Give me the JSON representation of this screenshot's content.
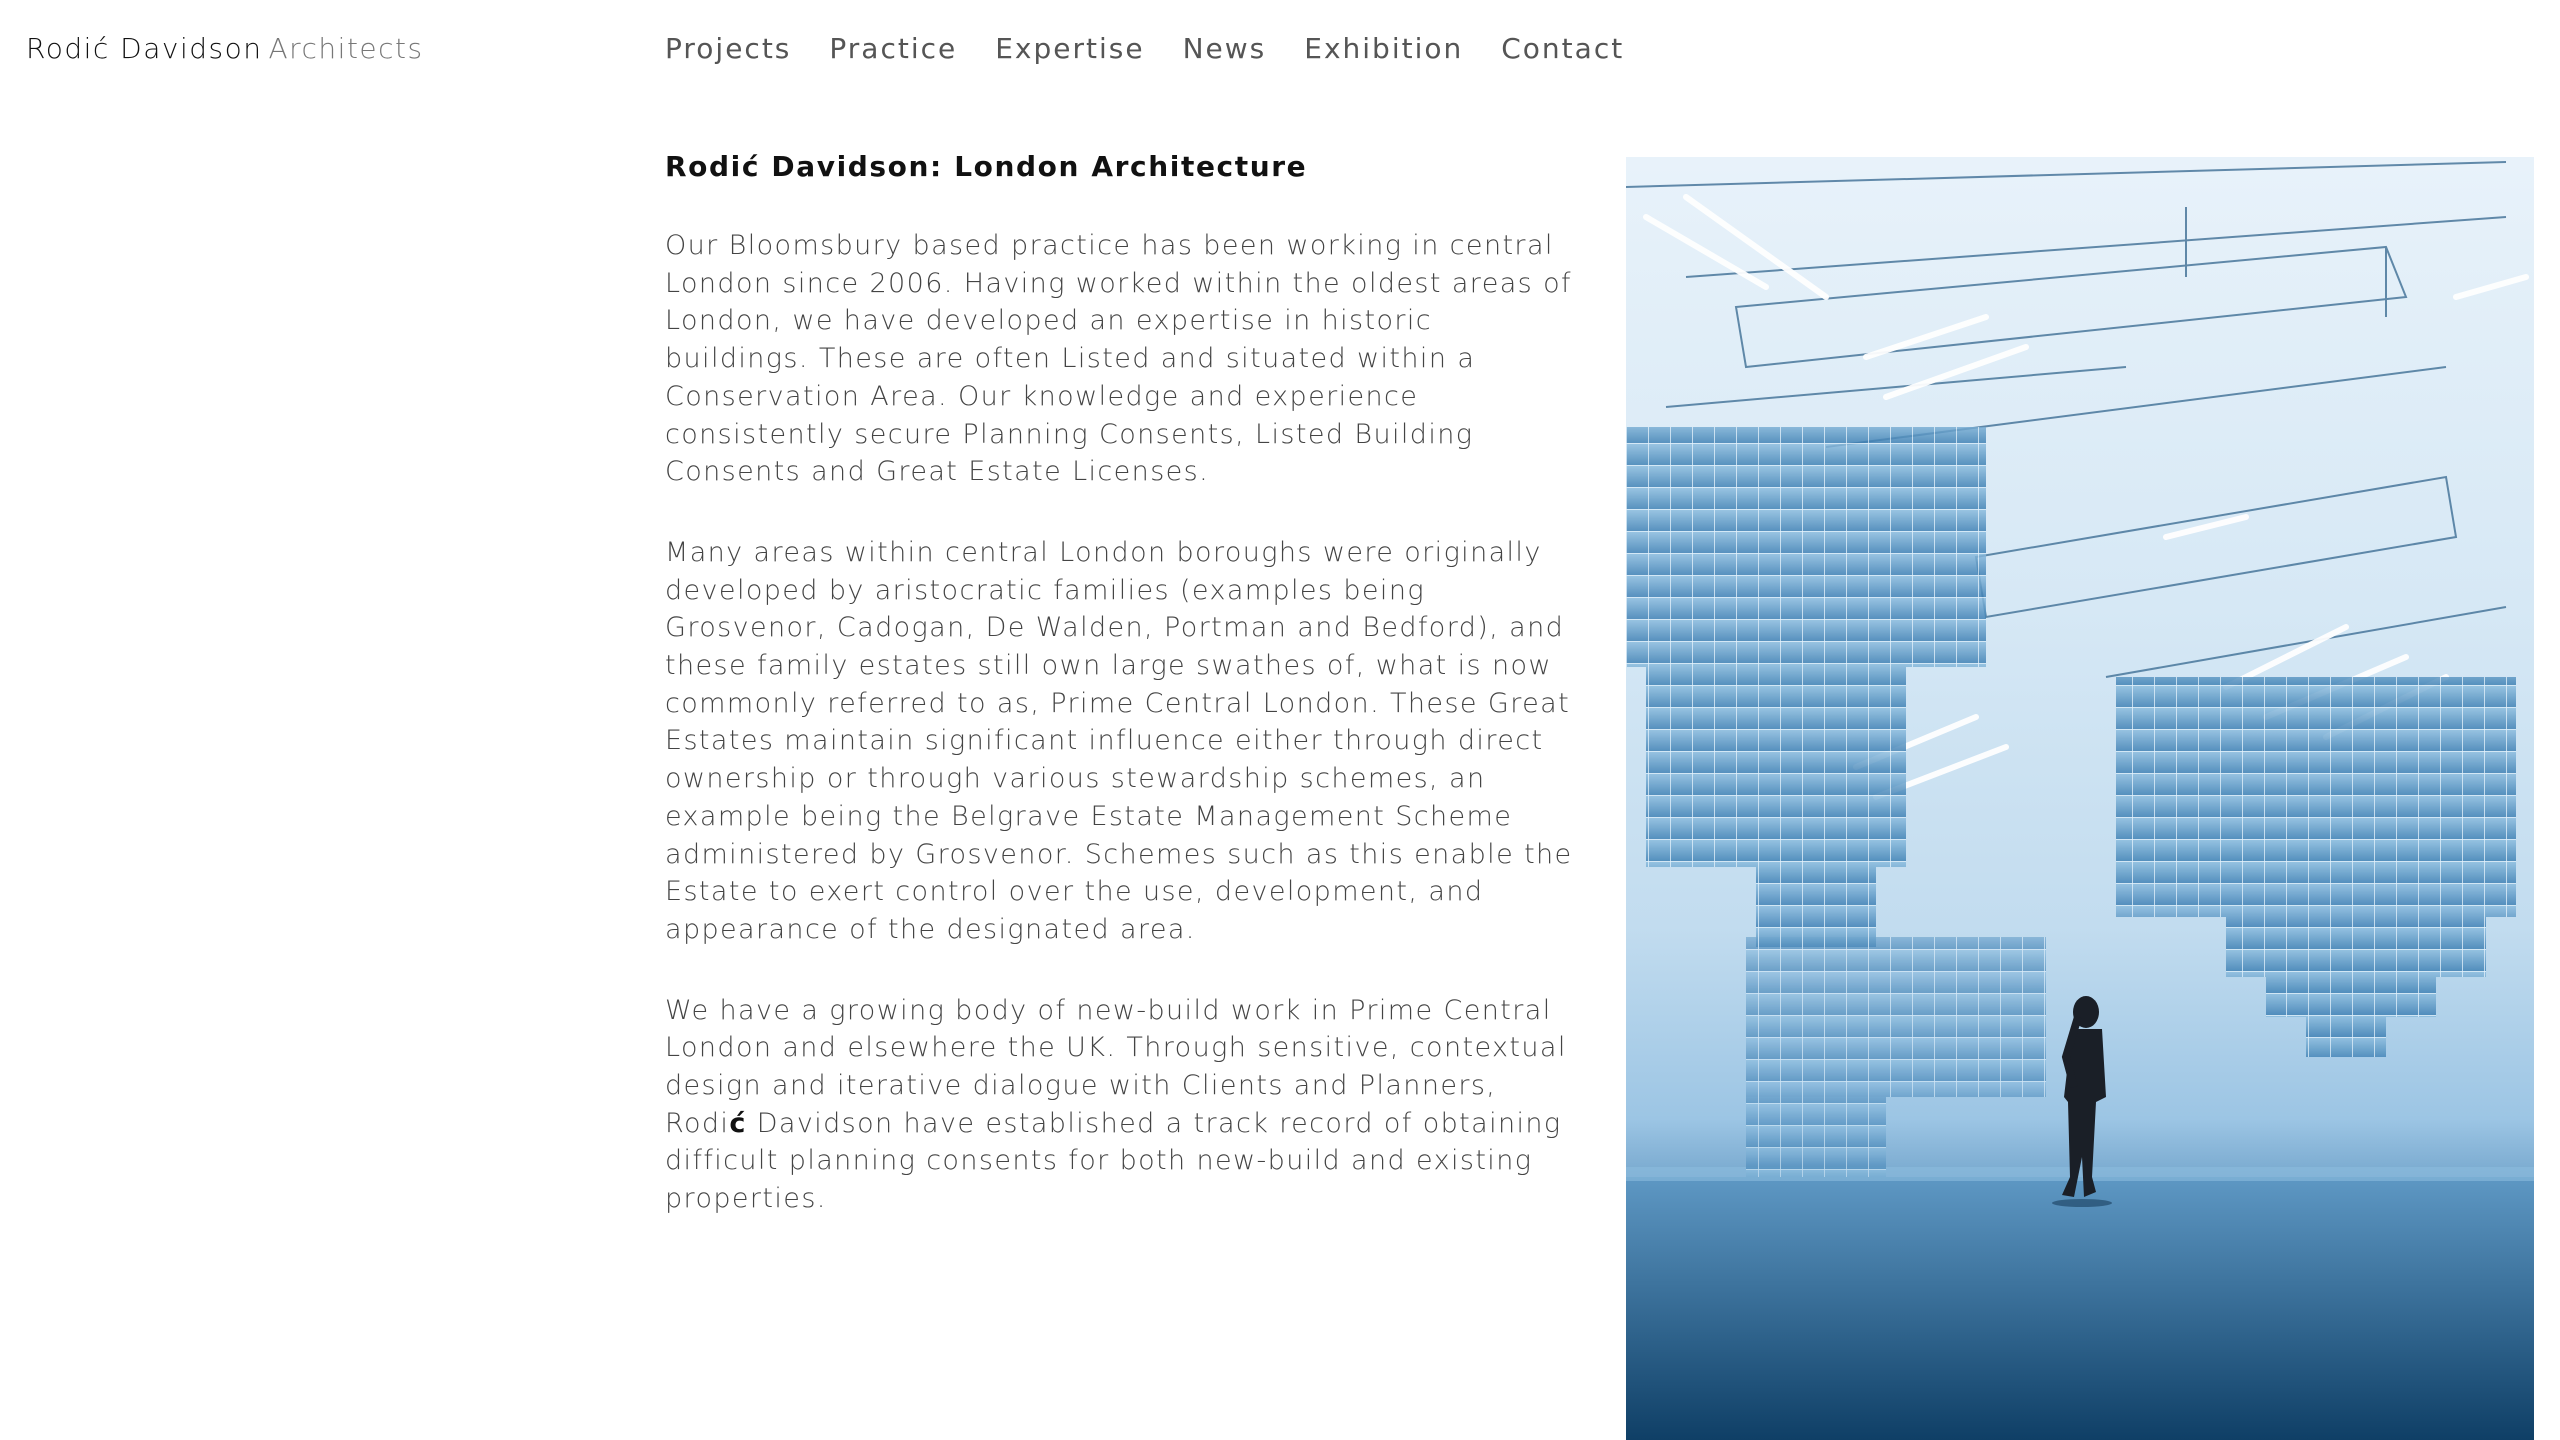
{
  "brand": {
    "name": "Rodić Davidson",
    "suffix": "Architects"
  },
  "nav": {
    "items": [
      {
        "label": "Projects"
      },
      {
        "label": "Practice"
      },
      {
        "label": "Expertise"
      },
      {
        "label": "News"
      },
      {
        "label": "Exhibition"
      },
      {
        "label": "Contact"
      }
    ]
  },
  "article": {
    "title": "Rodić Davidson: London Architecture",
    "p1": "Our Bloomsbury based practice has been working in central London since 2006. Having worked within the oldest areas of London, we have developed an expertise in historic buildings. These are often Listed and situated within a Conservation Area. Our knowledge and experience consistently secure Planning Consents, Listed Building Consents and Great Estate Licenses.",
    "p2": "Many areas within central London boroughs were originally developed by aristocratic families (examples being Grosvenor, Cadogan, De Walden, Portman and Bedford), and these family estates still own large swathes of, what is now commonly referred to as, Prime Central London. These Great Estates maintain significant influence either through direct ownership or through various stewardship schemes, an example being the Belgrave Estate Management Scheme administered by Grosvenor. Schemes such as this enable the Estate to exert control over the use, development, and appearance of the designated area.",
    "p3_before": "We have a growing body of new-build work in Prime Central London and elsewhere the UK. Through sensitive, contextual design and iterative dialogue with Clients and Planners, Rodi",
    "p3_emph": "ć",
    "p3_after": " Davidson have established a track record of obtaining difficult planning consents for both new-build and existing properties."
  },
  "hero": {
    "icon": "gallery-installation-photo",
    "colors": {
      "sky": "#e8f2fa",
      "floor": "#1f5a8a",
      "glass": "#6fa6cf"
    }
  }
}
